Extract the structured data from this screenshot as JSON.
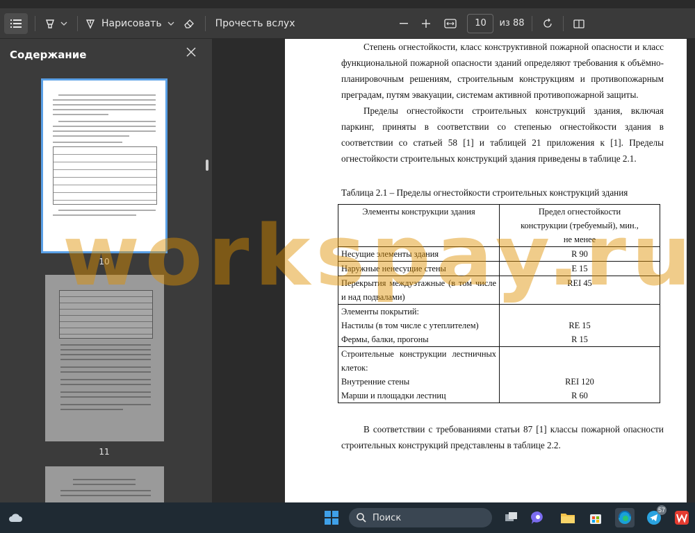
{
  "toolbar": {
    "draw_label": "Нарисовать",
    "read_aloud_label": "Прочесть вслух",
    "page_current": "10",
    "page_total": "из 88"
  },
  "sidebar": {
    "title": "Содержание",
    "thumbnails": [
      {
        "label": "10"
      },
      {
        "label": "11"
      }
    ]
  },
  "document": {
    "p1": "Степень огнестойкости, класс конструктивной пожарной опасности и класс функциональной пожарной опасности зданий определяют требования к объёмно-планировочным решениям, строительным конструкциям и противопожарным преградам, путям эвакуации, системам активной противопожарной защиты.",
    "p2": "Пределы огнестойкости строительных конструкций здания, включая паркинг, приняты в соответствии со степенью огнестойкости здания в соответствии со статьей 58 [1] и таблицей 21 приложения к [1]. Пределы огнестойкости строительных конструкций здания приведены в таблице 2.1.",
    "table_caption": "Таблица 2.1 – Пределы огнестойкости строительных конструкций здания",
    "table": {
      "header_col1": "Элементы конструкции здания",
      "header_col2": "Предел огнестойкости конструкции (требуемый), мин., не менее",
      "rows": [
        {
          "element": "Несущие элементы здания",
          "value": "R 90"
        },
        {
          "element": "Наружные ненесущие стены",
          "value": "E 15"
        },
        {
          "element": "Перекрытия междуэтажные (в том числе и над подвалами)",
          "value": "REI 45"
        }
      ],
      "roof_title": "Элементы покрытий:",
      "roof_rows": [
        {
          "element": "Настилы (в том числе с утеплителем)",
          "value": "RE 15"
        },
        {
          "element": "Фермы, балки, прогоны",
          "value": "R 15"
        }
      ],
      "stair_title": "Строительные конструкции лестничных клеток:",
      "stair_rows": [
        {
          "element": "Внутренние стены",
          "value": "REI 120"
        },
        {
          "element": "Марши и площадки лестниц",
          "value": "R 60"
        }
      ]
    },
    "p3": "В соответствии с требованиями статьи 87 [1] классы пожарной опасности строительных конструкций представлены в таблице 2.2."
  },
  "watermark": "workspay.ru",
  "taskbar": {
    "search_label": "Поиск",
    "telegram_badge": "57"
  },
  "colors": {
    "toolbar_bg": "#3a3a3a",
    "sidebar_bg": "#3b3b3b",
    "canvas_bg": "#2b2b2b",
    "accent": "#5aa0e6",
    "watermark": "#de8f00"
  }
}
